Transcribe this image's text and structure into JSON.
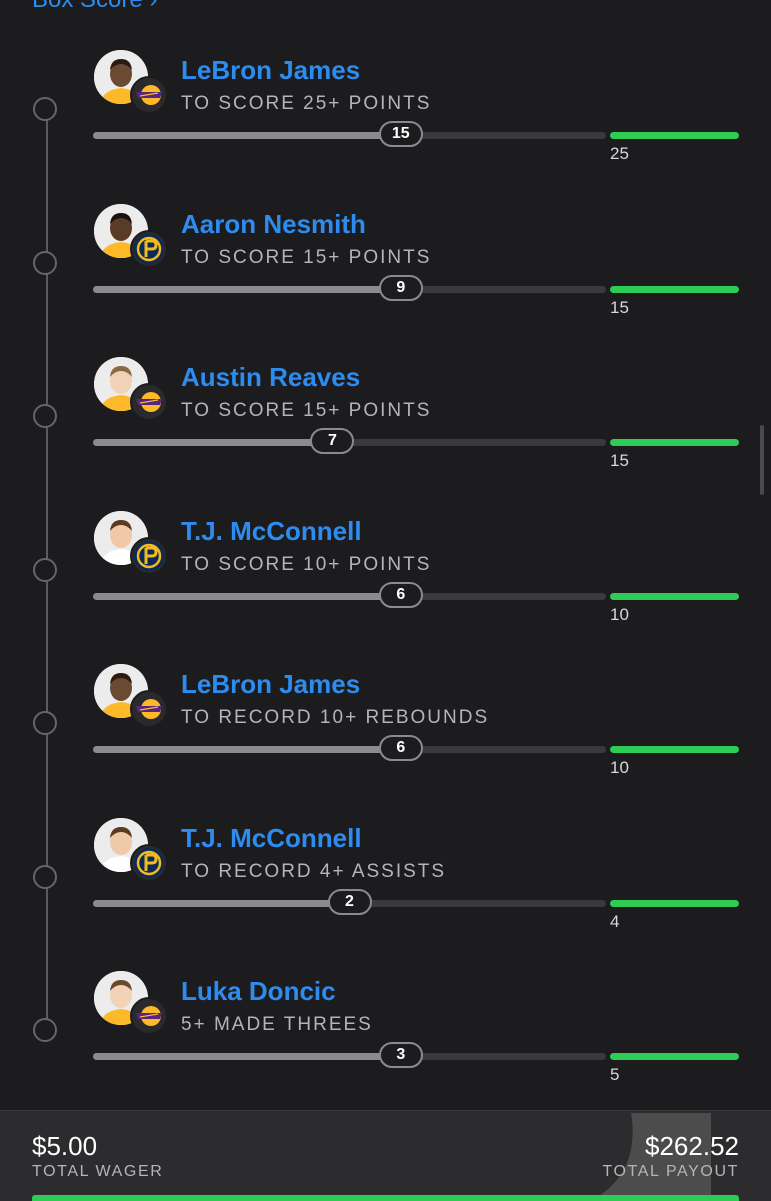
{
  "header": {
    "box_score_link": "Box Score ›"
  },
  "legs": [
    {
      "player": "LeBron James",
      "prop": "TO SCORE 25+ POINTS",
      "current": 15,
      "target": 25,
      "team": "lakers",
      "progress": 0.6
    },
    {
      "player": "Aaron Nesmith",
      "prop": "TO SCORE 15+ POINTS",
      "current": 9,
      "target": 15,
      "team": "pacers",
      "progress": 0.6
    },
    {
      "player": "Austin Reaves",
      "prop": "TO SCORE 15+ POINTS",
      "current": 7,
      "target": 15,
      "team": "lakers",
      "progress": 0.4667
    },
    {
      "player": "T.J. McConnell",
      "prop": "TO SCORE 10+ POINTS",
      "current": 6,
      "target": 10,
      "team": "pacers",
      "progress": 0.6
    },
    {
      "player": "LeBron James",
      "prop": "TO RECORD 10+ REBOUNDS",
      "current": 6,
      "target": 10,
      "team": "lakers",
      "progress": 0.6
    },
    {
      "player": "T.J. McConnell",
      "prop": "TO RECORD 4+ ASSISTS",
      "current": 2,
      "target": 4,
      "team": "pacers",
      "progress": 0.5
    },
    {
      "player": "Luka Doncic",
      "prop": "5+ MADE THREES",
      "current": 3,
      "target": 5,
      "team": "lakers",
      "progress": 0.6
    }
  ],
  "footer": {
    "wager_amount": "$5.00",
    "wager_label": "TOTAL WAGER",
    "payout_amount": "$262.52",
    "payout_label": "TOTAL PAYOUT"
  },
  "colors": {
    "accent_blue": "#2d8cf0",
    "target_green": "#2ecc55",
    "background": "#1c1c1e"
  }
}
